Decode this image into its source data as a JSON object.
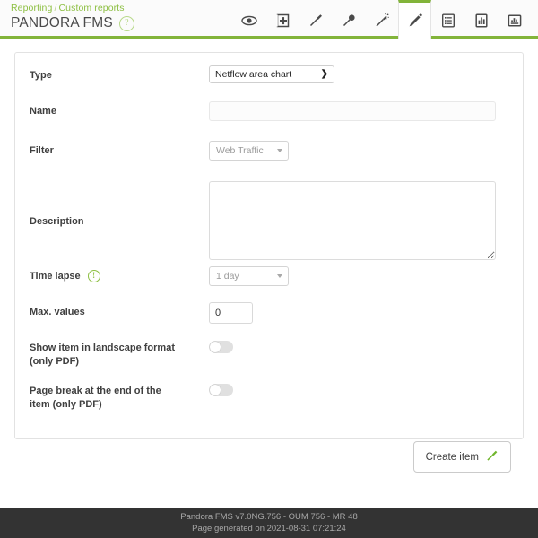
{
  "header": {
    "breadcrumb": {
      "parent": "Reporting",
      "separator": "/",
      "current": "Custom reports"
    },
    "title": "PANDORA FMS",
    "help_icon": "?",
    "help_icon_name": "help-question-icon",
    "accent_color": "#82b43a",
    "breadcrumb_color": "#8dbf42"
  },
  "toolbar": {
    "tabs": [
      {
        "name": "eye-icon",
        "label": "View",
        "active": false
      },
      {
        "name": "add-item-box-icon",
        "label": "Add item",
        "active": false
      },
      {
        "name": "pin-icon",
        "label": "Pin",
        "active": false
      },
      {
        "name": "pin-round-icon",
        "label": "Item editor",
        "active": false
      },
      {
        "name": "magic-wand-icon",
        "label": "Wizard",
        "active": false
      },
      {
        "name": "pencil-icon",
        "label": "Edit",
        "active": true
      },
      {
        "name": "list-icon",
        "label": "List items",
        "active": false
      },
      {
        "name": "bar-chart-icon",
        "label": "Global",
        "active": false
      },
      {
        "name": "chart-baseline-icon",
        "label": "Advanced",
        "active": false
      }
    ]
  },
  "form": {
    "type": {
      "label": "Type",
      "value": "Netflow area chart",
      "options": [
        "Netflow area chart"
      ]
    },
    "name": {
      "label": "Name",
      "value": "",
      "placeholder": ""
    },
    "filter": {
      "label": "Filter",
      "value": "Web Traffic",
      "options": [
        "Web Traffic"
      ]
    },
    "description": {
      "label": "Description",
      "value": "",
      "placeholder": ""
    },
    "time_lapse": {
      "label": "Time lapse",
      "value": "1 day",
      "options": [
        "1 day"
      ],
      "info_icon": "!"
    },
    "max_values": {
      "label": "Max. values",
      "value": "0"
    },
    "landscape": {
      "label": "Show item in landscape format (only PDF)",
      "state": "off"
    },
    "page_break": {
      "label": "Page break at the end of the item (only PDF)",
      "state": "off"
    }
  },
  "actions": {
    "create_item_label": "Create item",
    "create_item_icon": "pin-green-icon"
  },
  "footer": {
    "line1": "Pandora FMS v7.0NG.756 - OUM 756 - MR 48",
    "line2": "Page generated on 2021-08-31 07:21:24"
  }
}
